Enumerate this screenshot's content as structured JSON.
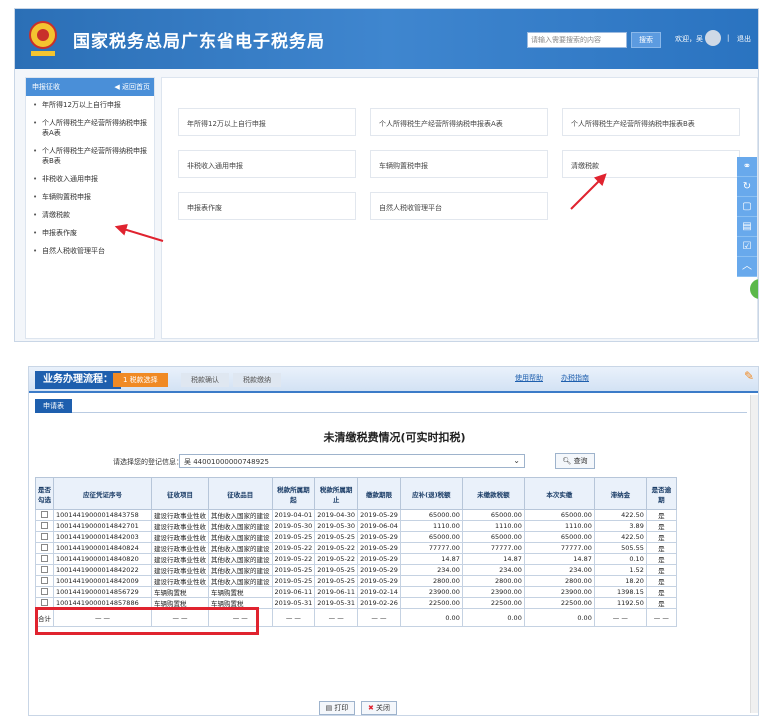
{
  "header": {
    "title": "国家税务总局广东省电子税务局",
    "search_placeholder": "请输入需要搜索的内容",
    "search_button": "搜索",
    "welcome": "欢迎，吴",
    "separator": "|",
    "logout": "退出"
  },
  "sidebar": {
    "title": "申报征收",
    "back": "返回首页",
    "items": [
      {
        "label": "年所得12万以上自行申报"
      },
      {
        "label": "个人所得税生产经营所得纳税申报表A表"
      },
      {
        "label": "个人所得税生产经营所得纳税申报表B表"
      },
      {
        "label": "非税收入通用申报"
      },
      {
        "label": "车辆购置税申报"
      },
      {
        "label": "清缴税款"
      },
      {
        "label": "申报表作废"
      },
      {
        "label": "自然人税收管理平台"
      }
    ]
  },
  "panel": {
    "tiles": [
      {
        "label": "年所得12万以上自行申报"
      },
      {
        "label": "个人所得税生产经营所得纳税申报表A表"
      },
      {
        "label": "个人所得税生产经营所得纳税申报表B表"
      },
      {
        "label": "非税收入通用申报"
      },
      {
        "label": "车辆购置税申报"
      },
      {
        "label": "清缴税款"
      },
      {
        "label": "申报表作废"
      },
      {
        "label": "自然人税收管理平台"
      }
    ]
  },
  "flow": {
    "label": "业务办理流程：",
    "steps": [
      "1 税款选择",
      "税款确认",
      "税款缴纳"
    ],
    "help": "使用帮助",
    "help2": "办税指南"
  },
  "tab": "申请表",
  "table": {
    "title": "未清缴税费情况(可实时扣税)",
    "reg_label": "请选择您的登记信息：",
    "reg_value": "吴                    44001000000748925",
    "query": "查询",
    "headers": [
      "是否勾选",
      "应征凭证序号",
      "征收项目",
      "征收品目",
      "税款所属期起",
      "税款所属期止",
      "缴款期限",
      "应补(退)税额",
      "未缴款税额",
      "本次实缴",
      "滞纳金",
      "是否逾期"
    ],
    "rows": [
      [
        "10014419000014843758",
        "建设行政事业性收",
        "其他收入国家的建设",
        "2019-04-01",
        "2019-04-30",
        "2019-05-29",
        "65000.00",
        "65000.00",
        "65000.00",
        "422.50",
        "是"
      ],
      [
        "10014419000014842701",
        "建设行政事业性收",
        "其他收入国家的建设",
        "2019-05-30",
        "2019-05-30",
        "2019-06-04",
        "1110.00",
        "1110.00",
        "1110.00",
        "3.89",
        "是"
      ],
      [
        "10014419000014842003",
        "建设行政事业性收",
        "其他收入国家的建设",
        "2019-05-25",
        "2019-05-25",
        "2019-05-29",
        "65000.00",
        "65000.00",
        "65000.00",
        "422.50",
        "是"
      ],
      [
        "10014419000014840824",
        "建设行政事业性收",
        "其他收入国家的建设",
        "2019-05-22",
        "2019-05-22",
        "2019-05-29",
        "77777.00",
        "77777.00",
        "77777.00",
        "505.55",
        "是"
      ],
      [
        "10014419000014840820",
        "建设行政事业性收",
        "其他收入国家的建设",
        "2019-05-22",
        "2019-05-22",
        "2019-05-29",
        "14.87",
        "14.87",
        "14.87",
        "0.10",
        "是"
      ],
      [
        "10014419000014842022",
        "建设行政事业性收",
        "其他收入国家的建设",
        "2019-05-25",
        "2019-05-25",
        "2019-05-29",
        "234.00",
        "234.00",
        "234.00",
        "1.52",
        "是"
      ],
      [
        "10014419000014842009",
        "建设行政事业性收",
        "其他收入国家的建设",
        "2019-05-25",
        "2019-05-25",
        "2019-05-29",
        "2800.00",
        "2800.00",
        "2800.00",
        "18.20",
        "是"
      ],
      [
        "10014419000014856729",
        "车辆购置税",
        "车辆购置税",
        "2019-06-11",
        "2019-06-11",
        "2019-02-14",
        "23900.00",
        "23900.00",
        "23900.00",
        "1398.15",
        "是"
      ],
      [
        "10014419000014857886",
        "车辆购置税",
        "车辆购置税",
        "2019-05-31",
        "2019-05-31",
        "2019-02-26",
        "22500.00",
        "22500.00",
        "22500.00",
        "1192.50",
        "是"
      ]
    ],
    "total_label": "合计",
    "total_row": [
      "— —",
      "— —",
      "— —",
      "— —",
      "— —",
      "— —",
      "0.00",
      "0.00",
      "0.00",
      "— —",
      "— —"
    ]
  },
  "buttons": {
    "print": "打印",
    "close": "关闭"
  },
  "colors": {
    "header_blue": "#2b6fb6",
    "flow_orange": "#f08a24",
    "annotation_red": "#e0232f"
  }
}
